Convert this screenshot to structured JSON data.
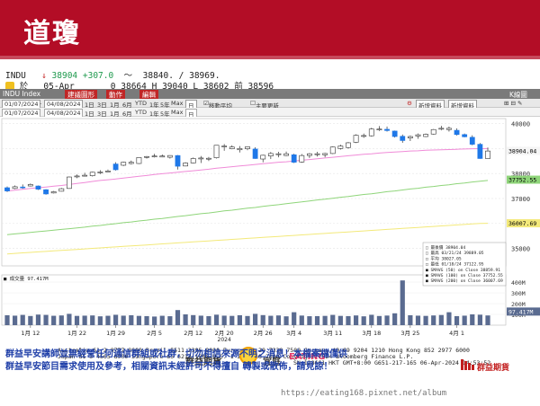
{
  "banner": {
    "title": "道瓊"
  },
  "quote": {
    "symbol": "INDU",
    "last": "38904",
    "change": "+307.0",
    "range": "38840. / 38969.",
    "market": "於",
    "date": "05-Apr",
    "open_label": "0",
    "open": "38664",
    "high_label": "H",
    "high": "39040",
    "low_label": "L",
    "low": "38602",
    "prev_label": "前",
    "prev": "38596"
  },
  "toolbar": {
    "index": "INDU Index",
    "btn1": "建議圖形",
    "btn2": "動作",
    "btn3": "編輯",
    "right": "K線圖"
  },
  "subbar": {
    "start": "01/07/2024",
    "end": "04/08/2024",
    "periods": [
      "1日",
      "3日",
      "1月",
      "6月",
      "YTD",
      "1年",
      "5年",
      "Max"
    ],
    "freq": "日",
    "check1": "移動平均",
    "check2": "主要更新",
    "right1": "新增資料",
    "right2": "新增資料",
    "right_icons": "⊞ ⊟ ✎"
  },
  "subbar2": {
    "start": "01/07/2024",
    "end": "04/08/2024",
    "periods": [
      "1日",
      "3日",
      "1月",
      "6月",
      "YTD",
      "1年",
      "5年",
      "Max"
    ],
    "freq": "日"
  },
  "chart_data": {
    "type": "candlestick",
    "y_ticks": [
      "40000",
      "39000",
      "38000",
      "37000",
      "36000",
      "35000"
    ],
    "ylim": [
      34300,
      40200
    ],
    "volume_ticks": [
      "400M",
      "300M",
      "200M",
      "100M"
    ],
    "volume_ylim": [
      0,
      400
    ],
    "x_ticks": [
      "1月 12",
      "1月 22",
      "1月 29",
      "2月 5",
      "2月 12",
      "2月 20",
      "2月 26",
      "3月 4",
      "3月 11",
      "3月 18",
      "3月 25",
      "4月 1"
    ],
    "year_label": "2024",
    "candles": [
      {
        "o": 37430,
        "h": 37480,
        "l": 37260,
        "c": 37300,
        "up": false
      },
      {
        "o": 37400,
        "h": 37520,
        "l": 37370,
        "c": 37470,
        "up": true
      },
      {
        "o": 37460,
        "h": 37560,
        "l": 37390,
        "c": 37450,
        "up": false
      },
      {
        "o": 37500,
        "h": 37600,
        "l": 37480,
        "c": 37560,
        "up": true
      },
      {
        "o": 37500,
        "h": 37520,
        "l": 37340,
        "c": 37370,
        "up": false
      },
      {
        "o": 37350,
        "h": 37370,
        "l": 37150,
        "c": 37180,
        "up": false
      },
      {
        "o": 37220,
        "h": 37300,
        "l": 37200,
        "c": 37270,
        "up": true
      },
      {
        "o": 37290,
        "h": 37420,
        "l": 37280,
        "c": 37390,
        "up": true
      },
      {
        "o": 37400,
        "h": 37880,
        "l": 37390,
        "c": 37860,
        "up": true
      },
      {
        "o": 37880,
        "h": 37960,
        "l": 37810,
        "c": 37900,
        "up": true
      },
      {
        "o": 37930,
        "h": 38030,
        "l": 37880,
        "c": 37900,
        "up": true
      },
      {
        "o": 37910,
        "h": 38070,
        "l": 37880,
        "c": 38050,
        "up": true
      },
      {
        "o": 38060,
        "h": 38130,
        "l": 37980,
        "c": 38050,
        "up": true
      },
      {
        "o": 38080,
        "h": 38160,
        "l": 38060,
        "c": 38100,
        "up": true
      },
      {
        "o": 38380,
        "h": 38450,
        "l": 38120,
        "c": 38150,
        "up": false
      },
      {
        "o": 38330,
        "h": 38470,
        "l": 38300,
        "c": 38450,
        "up": true
      },
      {
        "o": 38450,
        "h": 38520,
        "l": 38360,
        "c": 38400,
        "up": true
      },
      {
        "o": 38400,
        "h": 38650,
        "l": 38380,
        "c": 38640,
        "up": true
      },
      {
        "o": 38650,
        "h": 38700,
        "l": 38600,
        "c": 38680,
        "up": true
      },
      {
        "o": 38680,
        "h": 38790,
        "l": 38640,
        "c": 38700,
        "up": true
      },
      {
        "o": 38700,
        "h": 38760,
        "l": 38650,
        "c": 38660,
        "up": true
      },
      {
        "o": 38650,
        "h": 38730,
        "l": 38600,
        "c": 38720,
        "up": true
      },
      {
        "o": 38720,
        "h": 38740,
        "l": 38160,
        "c": 38290,
        "up": false
      },
      {
        "o": 38300,
        "h": 38450,
        "l": 38290,
        "c": 38420,
        "up": true
      },
      {
        "o": 38420,
        "h": 38640,
        "l": 38400,
        "c": 38600,
        "up": true
      },
      {
        "o": 38590,
        "h": 38700,
        "l": 38420,
        "c": 38620,
        "up": true
      },
      {
        "o": 38600,
        "h": 38660,
        "l": 38500,
        "c": 38610,
        "up": true
      },
      {
        "o": 38630,
        "h": 39140,
        "l": 38600,
        "c": 39130,
        "up": true
      },
      {
        "o": 39100,
        "h": 39180,
        "l": 38910,
        "c": 39070,
        "up": true
      },
      {
        "o": 39060,
        "h": 39130,
        "l": 38970,
        "c": 38990,
        "up": true
      },
      {
        "o": 39000,
        "h": 39100,
        "l": 38840,
        "c": 38950,
        "up": true
      },
      {
        "o": 38990,
        "h": 39080,
        "l": 38930,
        "c": 39070,
        "up": true
      },
      {
        "o": 38980,
        "h": 39050,
        "l": 38590,
        "c": 38600,
        "up": false
      },
      {
        "o": 38580,
        "h": 38750,
        "l": 38450,
        "c": 38730,
        "up": true
      },
      {
        "o": 38700,
        "h": 38860,
        "l": 38580,
        "c": 38800,
        "up": true
      },
      {
        "o": 38780,
        "h": 38870,
        "l": 38650,
        "c": 38790,
        "up": true
      },
      {
        "o": 38790,
        "h": 38880,
        "l": 38700,
        "c": 38720,
        "up": true
      },
      {
        "o": 38750,
        "h": 38790,
        "l": 38420,
        "c": 38450,
        "up": false
      },
      {
        "o": 38460,
        "h": 38780,
        "l": 38430,
        "c": 38720,
        "up": true
      },
      {
        "o": 38720,
        "h": 38820,
        "l": 38620,
        "c": 38790,
        "up": true
      },
      {
        "o": 38790,
        "h": 38870,
        "l": 38680,
        "c": 38760,
        "up": true
      },
      {
        "o": 38750,
        "h": 38830,
        "l": 38650,
        "c": 38800,
        "up": true
      },
      {
        "o": 38800,
        "h": 39080,
        "l": 38780,
        "c": 39060,
        "up": true
      },
      {
        "o": 39100,
        "h": 39150,
        "l": 38960,
        "c": 39000,
        "up": true
      },
      {
        "o": 39040,
        "h": 39260,
        "l": 39000,
        "c": 39230,
        "up": true
      },
      {
        "o": 39250,
        "h": 39570,
        "l": 39220,
        "c": 39530,
        "up": true
      },
      {
        "o": 39500,
        "h": 39600,
        "l": 39430,
        "c": 39520,
        "up": true
      },
      {
        "o": 39510,
        "h": 39830,
        "l": 39480,
        "c": 39780,
        "up": true
      },
      {
        "o": 39780,
        "h": 39900,
        "l": 39700,
        "c": 39750,
        "up": true
      },
      {
        "o": 39770,
        "h": 39880,
        "l": 39680,
        "c": 39720,
        "up": false
      },
      {
        "o": 39700,
        "h": 39720,
        "l": 39440,
        "c": 39480,
        "up": false
      },
      {
        "o": 39490,
        "h": 39560,
        "l": 39230,
        "c": 39320,
        "up": false
      },
      {
        "o": 39420,
        "h": 39520,
        "l": 39300,
        "c": 39480,
        "up": true
      },
      {
        "o": 39550,
        "h": 39600,
        "l": 39390,
        "c": 39500,
        "up": true
      },
      {
        "o": 39480,
        "h": 39600,
        "l": 39460,
        "c": 39570,
        "up": true
      },
      {
        "o": 39580,
        "h": 39780,
        "l": 39560,
        "c": 39760,
        "up": true
      },
      {
        "o": 39800,
        "h": 39910,
        "l": 39730,
        "c": 39810,
        "up": true
      },
      {
        "o": 39810,
        "h": 39880,
        "l": 39680,
        "c": 39760,
        "up": true
      },
      {
        "o": 39730,
        "h": 39810,
        "l": 39520,
        "c": 39560,
        "up": false
      },
      {
        "o": 39560,
        "h": 39600,
        "l": 39450,
        "c": 39470,
        "up": false
      },
      {
        "o": 39450,
        "h": 39530,
        "l": 39130,
        "c": 39170,
        "up": false
      },
      {
        "o": 39170,
        "h": 39220,
        "l": 38590,
        "c": 38600,
        "up": false
      },
      {
        "o": 38600,
        "h": 39040,
        "l": 38600,
        "c": 38900,
        "up": true
      }
    ],
    "volumes": [
      92,
      88,
      95,
      85,
      98,
      95,
      87,
      90,
      105,
      86,
      88,
      90,
      82,
      87,
      96,
      88,
      92,
      86,
      84,
      80,
      87,
      83,
      140,
      100,
      93,
      88,
      84,
      97,
      88,
      86,
      92,
      85,
      105,
      93,
      87,
      90,
      82,
      120,
      89,
      83,
      84,
      86,
      95,
      86,
      84,
      90,
      82,
      96,
      85,
      89,
      110,
      415,
      92,
      88,
      86,
      90,
      94,
      120,
      84,
      88,
      100,
      97,
      90
    ],
    "series": [
      {
        "name": "SMAVG (50)",
        "values": [
          37300,
          37330,
          37370,
          37400,
          37430,
          37460,
          37490,
          37520,
          37560,
          37600,
          37640,
          37680,
          37720,
          37750,
          37780,
          37820,
          37850,
          37890,
          37920,
          37960,
          37990,
          38020,
          38050,
          38080,
          38110,
          38140,
          38170,
          38210,
          38240,
          38270,
          38300,
          38330,
          38360,
          38390,
          38420,
          38450,
          38470,
          38500,
          38530,
          38560,
          38590,
          38620,
          38650,
          38680,
          38710,
          38740,
          38770,
          38790,
          38820,
          38840,
          38860,
          38880,
          38900,
          38910,
          38930,
          38940,
          38950,
          38960,
          38970,
          38980,
          38990,
          38995,
          39000
        ]
      },
      {
        "name": "SMAVG (100)",
        "values": [
          35550,
          35580,
          35610,
          35640,
          35670,
          35700,
          35730,
          35760,
          35790,
          35820,
          35850,
          35890,
          35920,
          35960,
          35990,
          36030,
          36060,
          36100,
          36130,
          36170,
          36200,
          36240,
          36280,
          36310,
          36350,
          36390,
          36420,
          36460,
          36500,
          36530,
          36570,
          36610,
          36640,
          36680,
          36720,
          36750,
          36790,
          36830,
          36860,
          36900,
          36940,
          36970,
          37010,
          37050,
          37080,
          37120,
          37160,
          37190,
          37230,
          37270,
          37300,
          37340,
          37380,
          37410,
          37450,
          37480,
          37520,
          37550,
          37590,
          37620,
          37660,
          37690,
          37720
        ]
      },
      {
        "name": "SMAVG (200)",
        "values": [
          34780,
          34800,
          34820,
          34840,
          34860,
          34880,
          34900,
          34920,
          34940,
          34960,
          34980,
          35000,
          35020,
          35040,
          35060,
          35080,
          35100,
          35120,
          35140,
          35160,
          35180,
          35200,
          35220,
          35240,
          35260,
          35280,
          35300,
          35320,
          35340,
          35360,
          35380,
          35400,
          35420,
          35440,
          35460,
          35480,
          35500,
          35520,
          35540,
          35560,
          35580,
          35600,
          35620,
          35640,
          35660,
          35680,
          35700,
          35720,
          35740,
          35760,
          35780,
          35800,
          35820,
          35840,
          35860,
          35880,
          35900,
          35920,
          35940,
          35960,
          35980,
          36000,
          36007
        ]
      }
    ],
    "tags": {
      "last": "38904.04",
      "sma50": "37752.55",
      "sma100": "36007.69",
      "vol": "97.417M"
    },
    "legend": {
      "lines": [
        "□ 最後價  38904.04",
        "□ 最高 03/21/24  39889.05",
        "□ 平均  38027.05",
        "□ 最低 01/18/24  37122.95",
        "■ SMAVG (50) on Close  38859.91",
        "■ SMAVG (100) on Close  37752.55",
        "■ SMAVG (200) on Close  36007.69"
      ],
      "vol_label": "■ 成交量  97.417M"
    },
    "colors": {
      "up_body": "#ffffff",
      "down_body": "#1f78e8",
      "wick": "#333333",
      "sma50": "#f08bd8",
      "sma100": "#8fd57a",
      "sma200": "#f3e97a",
      "volume": "#5a6b90"
    }
  },
  "footer": {
    "line1": "Australia 61 2 9777 8600 Brazil 5511 2395 9000 Europe 44 20 7330 7500 Germany 49 69 9204 1210 Hong Kong 852 2977 6000",
    "line2": "Japan 81 3 4565 8900       Singapore 65 6212 1000    U.S. 1 212 318 2000       Copyright 2024 Bloomberg Finance L.P.",
    "line3": "SN 128661 HKT  GMT+8:00 G651-217-165 06-Apr-2024 14:53:52"
  },
  "disclaimer": {
    "line1": "群益早安講師並無經營任何通信群組或社群，切勿相信來源不明之消息！本檔案檔僅供",
    "line2": "群益早安節目需求使用及參考，相關資訊未經許可不得擅自 轉製或散佈，請見諒！"
  },
  "overlay": {
    "a": "群益期貨",
    "b": "宜庭",
    "c": "EATiNG"
  },
  "brand": {
    "name": "群益期貨"
  },
  "watermark": "https://eating168.pixnet.net/album"
}
